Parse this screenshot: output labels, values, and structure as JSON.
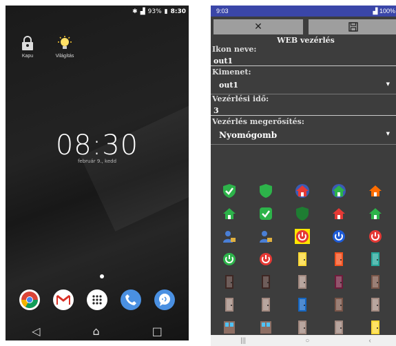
{
  "lock_screen": {
    "status_bar": {
      "battery": "93%",
      "time": "8:30",
      "network": "4G"
    },
    "widgets": [
      {
        "label": "Kapu",
        "icon": "padlock-icon"
      },
      {
        "label": "Világítás",
        "icon": "lightbulb-icon"
      }
    ],
    "clock": "08:30",
    "date": "február 9., kedd",
    "dock": [
      "chrome-icon",
      "gmail-icon",
      "app-drawer-icon",
      "phone-icon",
      "messages-icon"
    ]
  },
  "app_screen": {
    "status_bar": {
      "time": "9:03",
      "battery": "100%"
    },
    "toolbar": {
      "close": "✕",
      "save": "💾"
    },
    "title": "WEB vezérlés",
    "fields": {
      "icon_name_label": "Ikon neve:",
      "icon_name_value": "out1",
      "output_label": "Kimenet:",
      "output_value": "out1",
      "time_label": "Vezérlési idő:",
      "time_value": "3",
      "confirm_label": "Vezérlés megerősítés:",
      "confirm_value": "Nyomógomb"
    },
    "icon_grid": [
      "shield-check-green",
      "shield-green",
      "house-eye-red",
      "house-eye-green",
      "house-orange",
      "house-green",
      "check-box-green",
      "shield-green-dark",
      "house-red",
      "house-green-white",
      "user-lock-blue",
      "user-unlock-blue",
      "power-red-selected",
      "power-blue",
      "power-red-round",
      "power-green",
      "power-red",
      "door-yellow",
      "door-orange",
      "door-teal",
      "door-red-dark",
      "door-panel-dark",
      "door-window",
      "door-maroon",
      "door-brown",
      "door-wood-a",
      "door-wood-b",
      "door-blue-frame",
      "door-panel-brown",
      "door-wood-c",
      "window-blue",
      "window-tall",
      "door-glass",
      "door-stripes",
      "door-yellow-b"
    ]
  }
}
